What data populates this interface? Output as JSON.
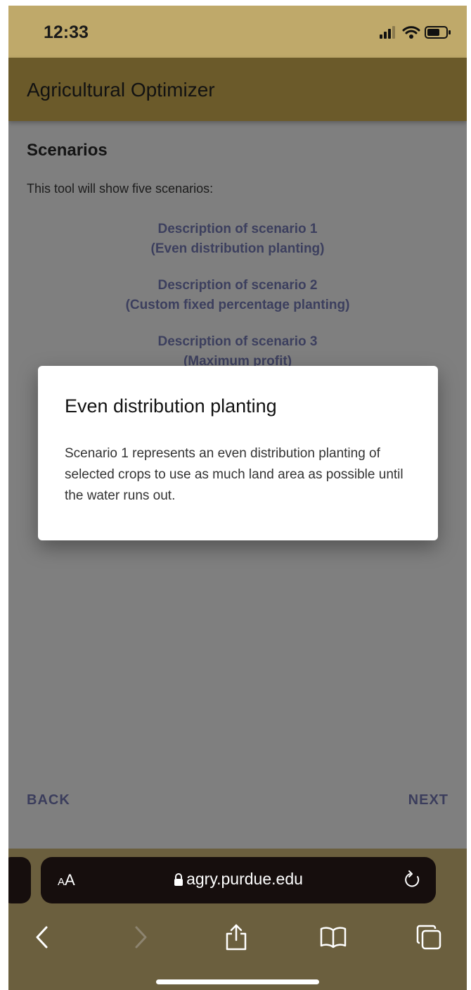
{
  "status_bar": {
    "time": "12:33"
  },
  "app": {
    "title": "Agricultural Optimizer"
  },
  "scenarios": {
    "title": "Scenarios",
    "intro": "This tool will show five scenarios:",
    "items": [
      {
        "line1": "Description of scenario 1",
        "line2": "(Even distribution planting)"
      },
      {
        "line1": "Description of scenario 2",
        "line2": "(Custom fixed percentage planting)"
      },
      {
        "line1": "Description of scenario 3",
        "line2": "(Maximum profit)"
      }
    ]
  },
  "dialog": {
    "title": "Even distribution planting",
    "body": "Scenario 1 represents an even distribution planting of selected crops to use as much land area as possible until the water runs out."
  },
  "navigation": {
    "back_label": "BACK",
    "next_label": "NEXT"
  },
  "browser": {
    "text_size_label_small": "A",
    "text_size_label_large": "A",
    "url": "agry.purdue.edu",
    "icons": {
      "lock": "lock-icon",
      "reload": "reload-icon",
      "back": "chevron-left-icon",
      "forward": "chevron-right-icon",
      "share": "share-icon",
      "bookmarks": "book-icon",
      "tabs": "tabs-icon"
    }
  },
  "colors": {
    "status_bar_bg": "#bfa96a",
    "app_bar_bg": "#6b5a2a",
    "link_text": "#3c3f5e",
    "overlay_bg": "#7f7f7f"
  }
}
